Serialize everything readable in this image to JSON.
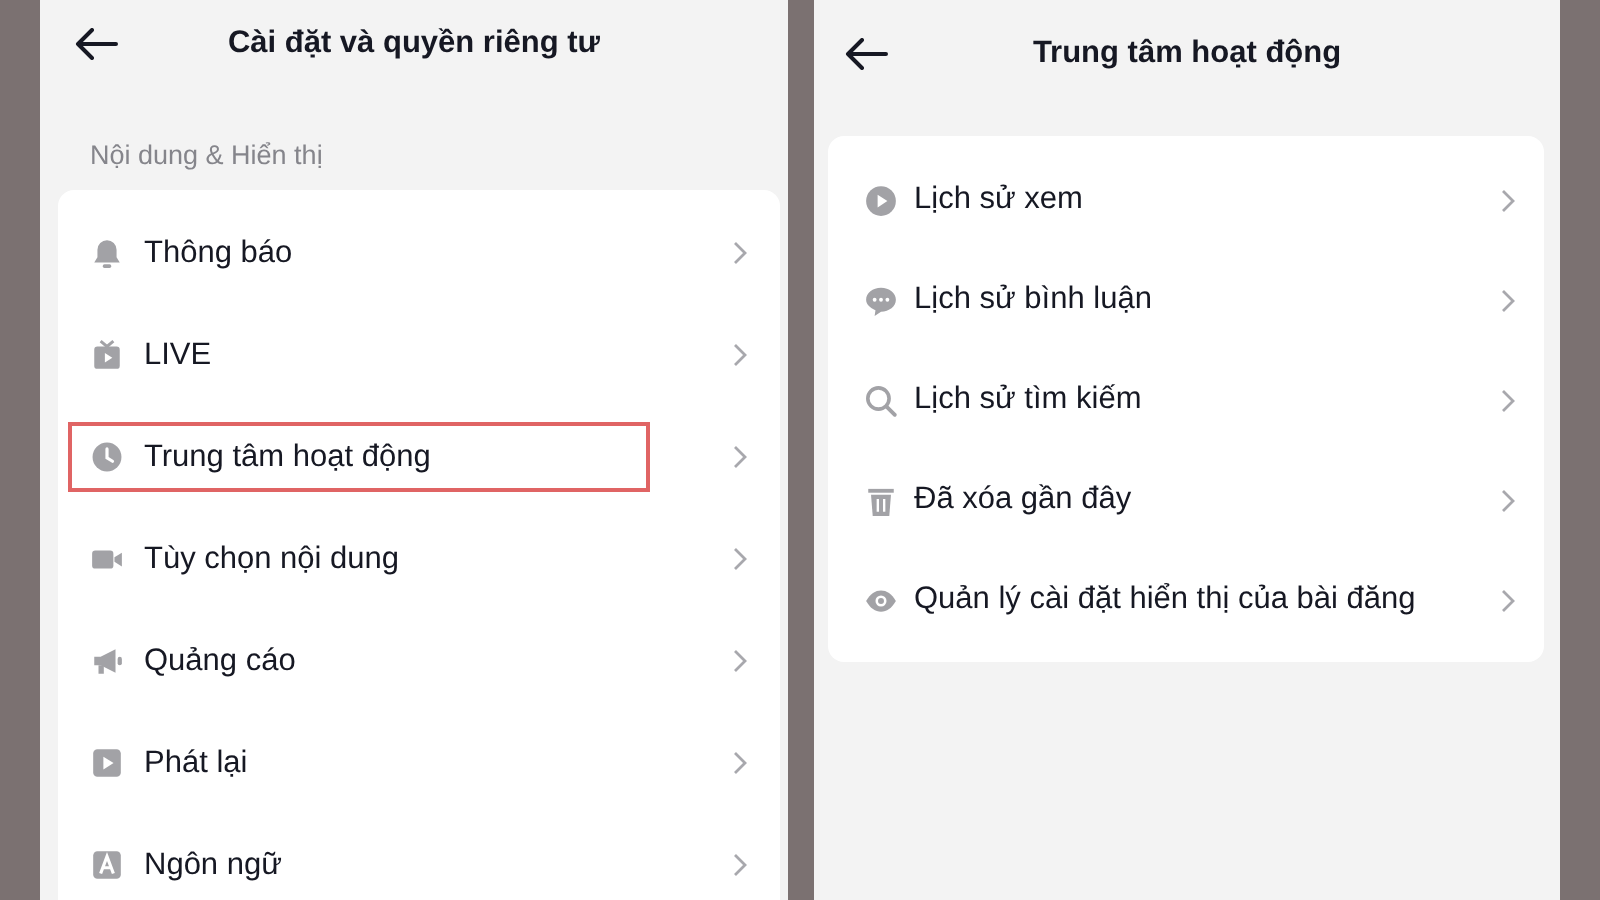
{
  "left_screen": {
    "title": "Cài đặt và quyền riêng tư",
    "section_label": "Nội dung & Hiển thị",
    "items": [
      {
        "label": "Thông báo",
        "highlighted": false
      },
      {
        "label": "LIVE",
        "highlighted": false
      },
      {
        "label": "Trung tâm hoạt động",
        "highlighted": true
      },
      {
        "label": "Tùy chọn nội dung",
        "highlighted": false
      },
      {
        "label": "Quảng cáo",
        "highlighted": false
      },
      {
        "label": "Phát lại",
        "highlighted": false
      },
      {
        "label": "Ngôn ngữ",
        "highlighted": false
      }
    ]
  },
  "right_screen": {
    "title": "Trung tâm hoạt động",
    "items": [
      {
        "label": "Lịch sử xem"
      },
      {
        "label": "Lịch sử bình luận"
      },
      {
        "label": "Lịch sử tìm kiếm"
      },
      {
        "label": "Đã xóa gần đây"
      },
      {
        "label": "Quản lý cài đặt hiển thị của bài đăng"
      }
    ]
  }
}
